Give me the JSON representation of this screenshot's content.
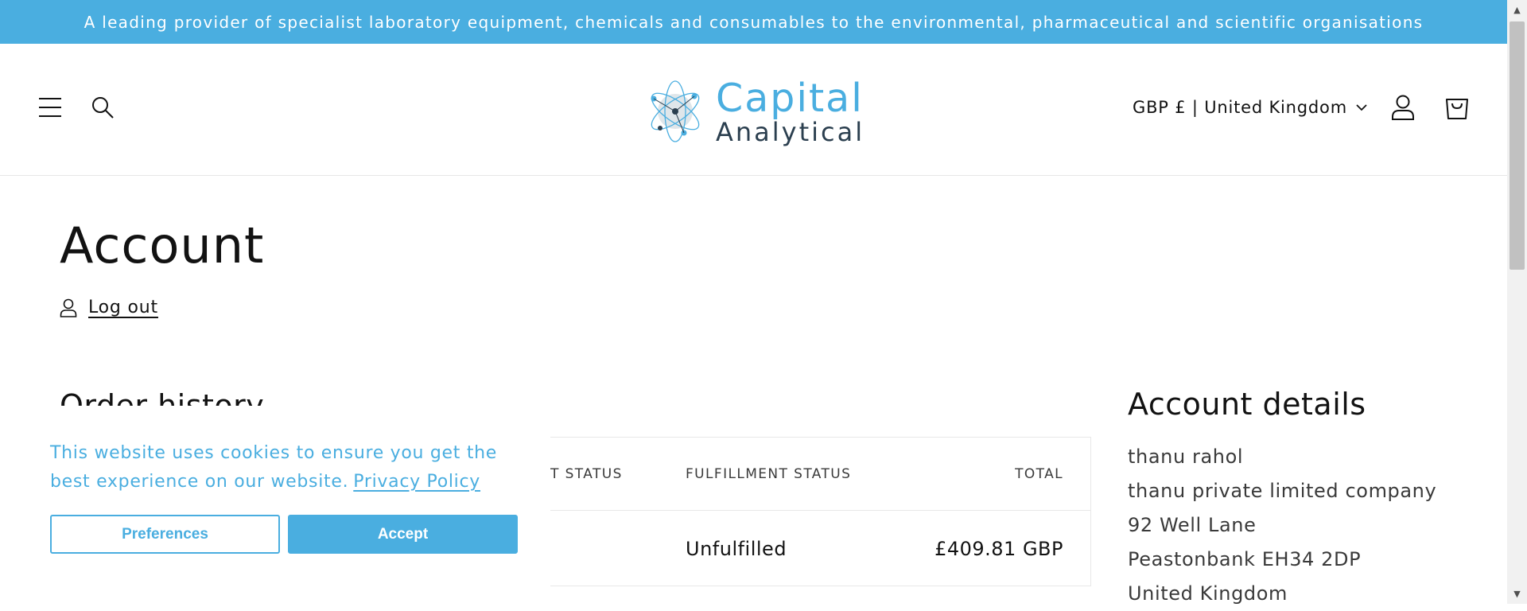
{
  "announcement": {
    "text": "A leading provider of specialist laboratory equipment, chemicals and consumables to the environmental, pharmaceutical and scientific organisations"
  },
  "header": {
    "logo": {
      "word1": "Capital",
      "word2": "Analytical"
    },
    "country_selector": "GBP £ | United Kingdom",
    "icons": [
      "menu-icon",
      "search-icon",
      "chevron-down-icon",
      "account-icon",
      "cart-icon"
    ]
  },
  "main": {
    "title": "Account",
    "logout_label": "Log out",
    "order_history": {
      "heading": "Order history",
      "columns": [
        "T STATUS",
        "FULFILLMENT STATUS",
        "TOTAL"
      ],
      "rows": [
        {
          "payment_status": "",
          "fulfillment_status": "Unfulfilled",
          "total": "£409.81 GBP"
        }
      ]
    },
    "account_details": {
      "heading": "Account details",
      "lines": [
        "thanu rahol",
        "thanu private limited company",
        "92 Well Lane",
        "Peastonbank EH34 2DP",
        "United Kingdom"
      ]
    }
  },
  "cookie_banner": {
    "text": "This website uses cookies to ensure you get the best experience on our website.",
    "privacy_link": "Privacy Policy",
    "preferences_label": "Preferences",
    "accept_label": "Accept"
  },
  "colors": {
    "accent": "#4aaee0",
    "text": "#121212",
    "logo_dark": "#2b3f4f"
  }
}
